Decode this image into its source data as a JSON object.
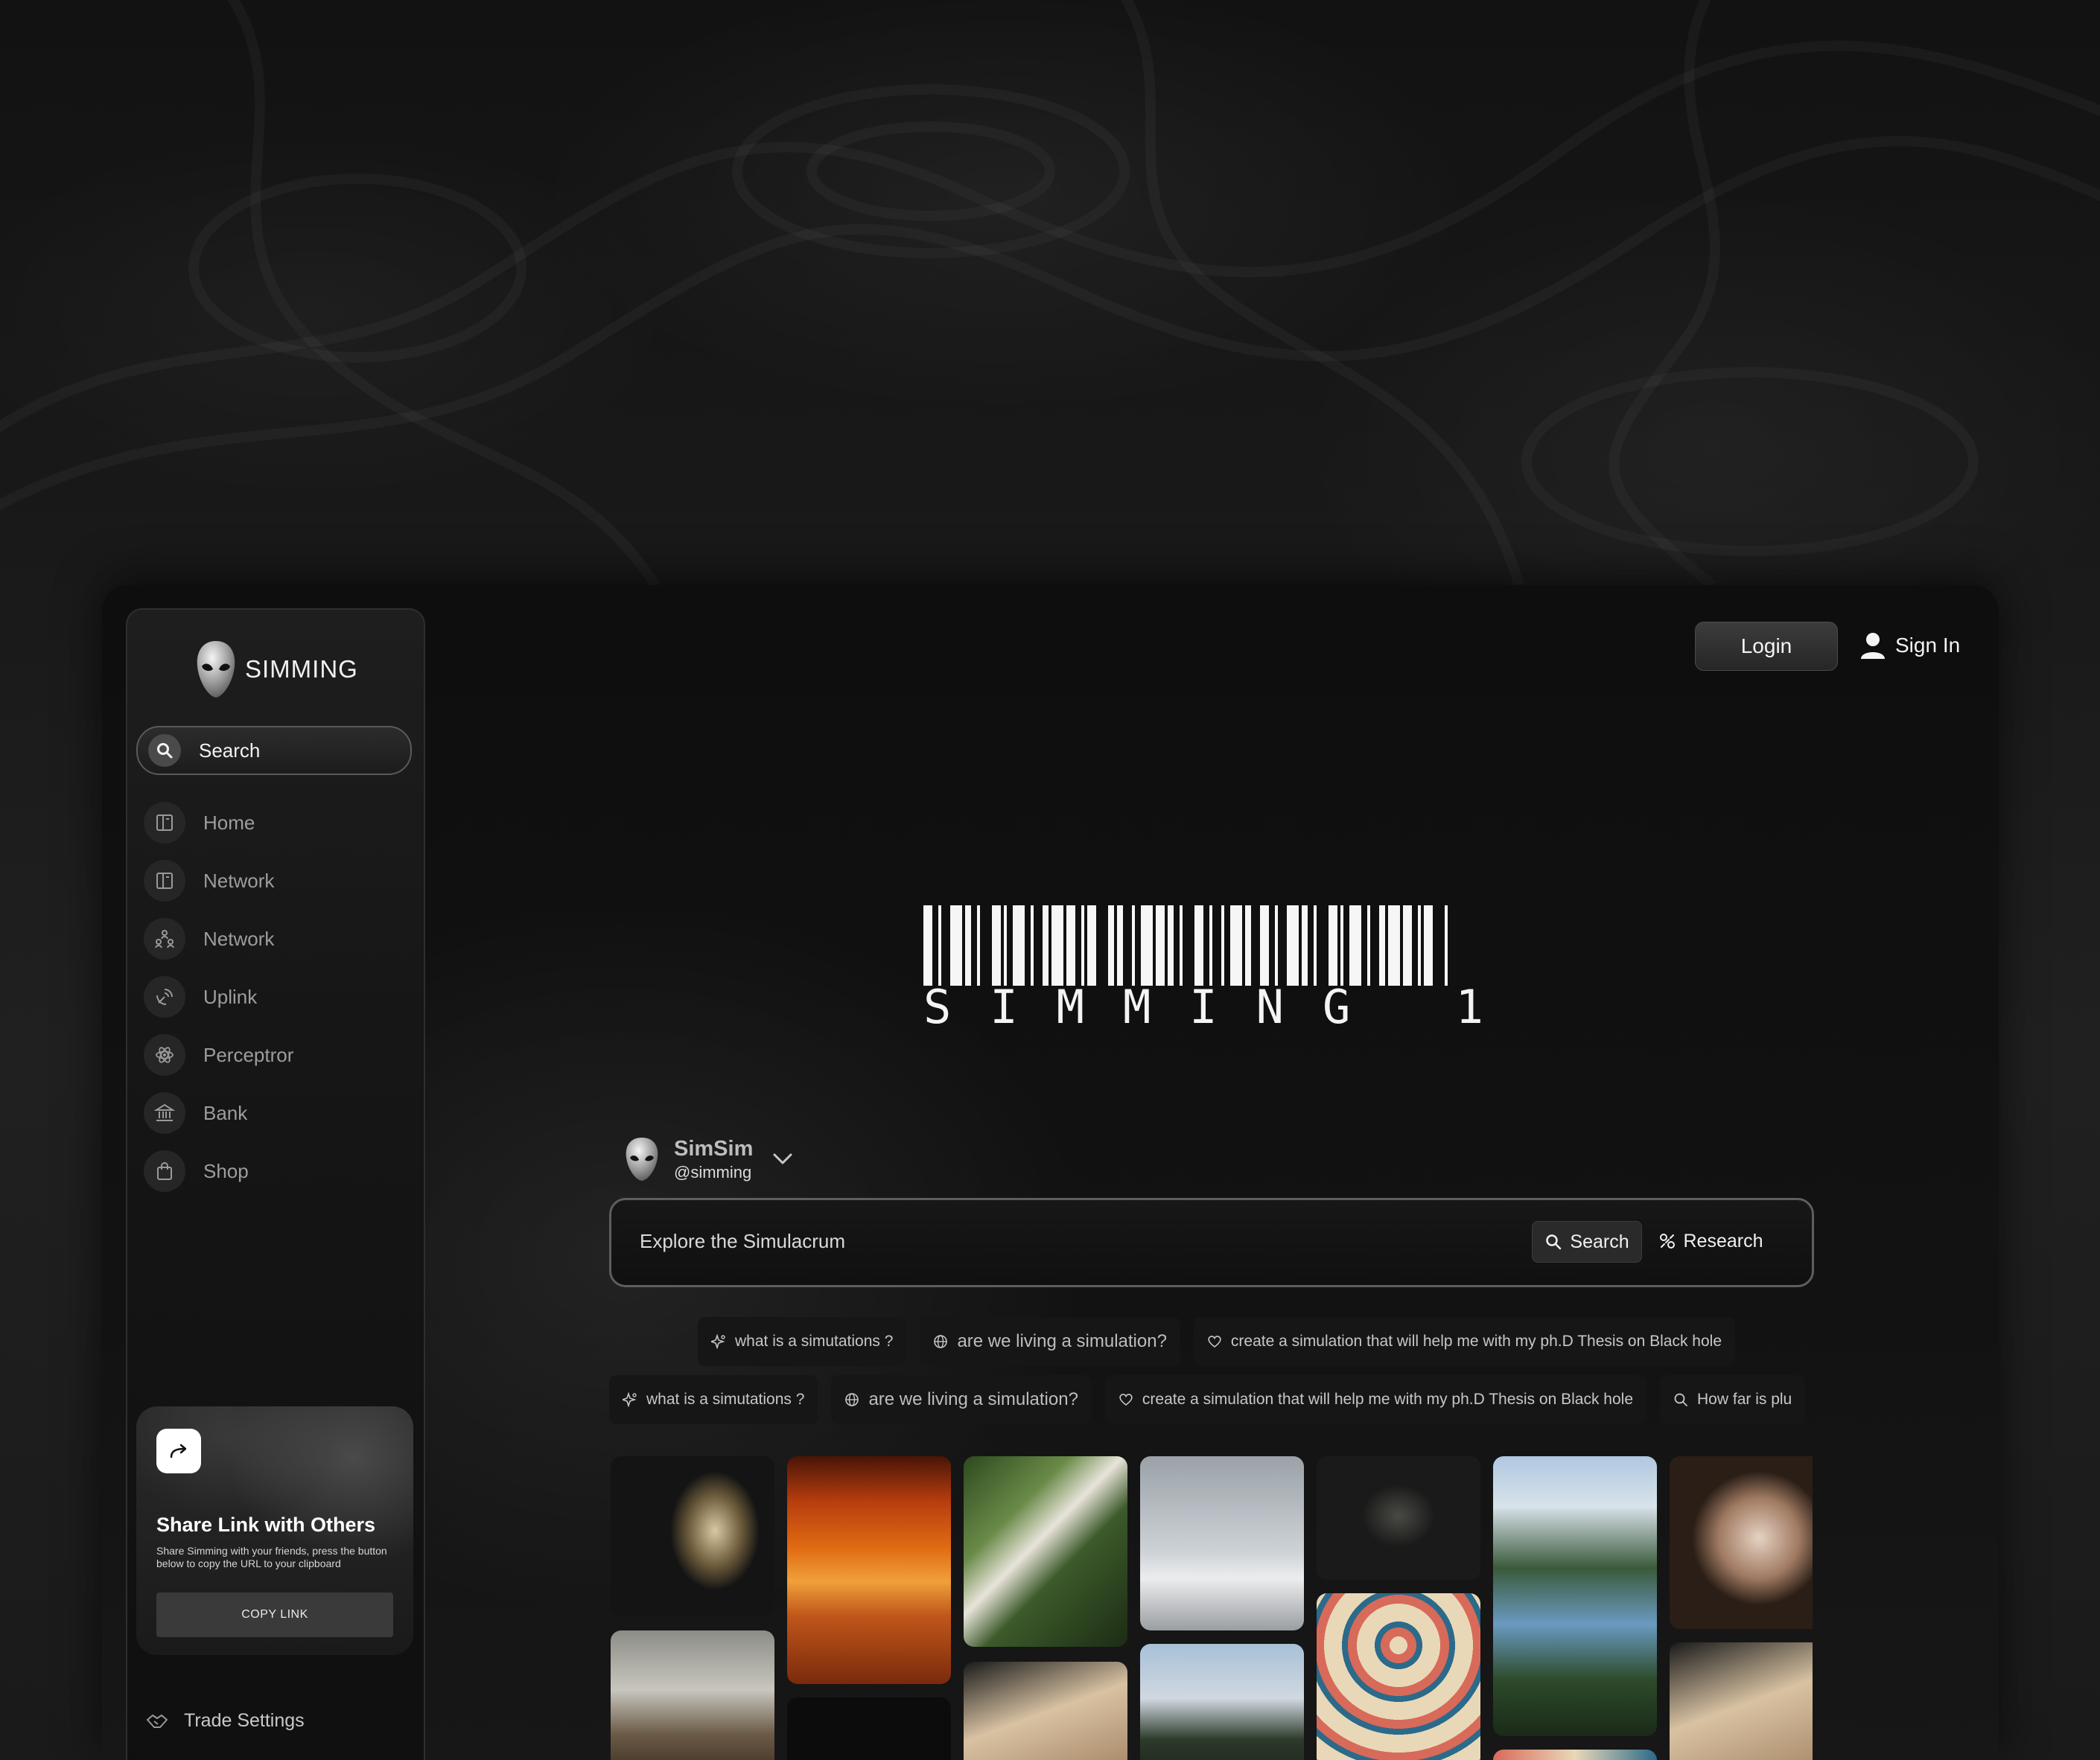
{
  "brand": {
    "name": "SIMMING"
  },
  "sidebar": {
    "search_label": "Search",
    "items": [
      {
        "label": "Home",
        "icon": "panel-icon"
      },
      {
        "label": "Network",
        "icon": "panel-icon"
      },
      {
        "label": "Network",
        "icon": "people-network-icon"
      },
      {
        "label": "Uplink",
        "icon": "satellite-icon"
      },
      {
        "label": "Perceptror",
        "icon": "atom-icon"
      },
      {
        "label": "Bank",
        "icon": "bank-icon"
      },
      {
        "label": "Shop",
        "icon": "shopping-bag-icon"
      }
    ],
    "share": {
      "title": "Share Link with Others",
      "text": "Share Simming with your friends, press the button below to copy the URL to your clipboard",
      "button": "COPY LINK"
    },
    "footer": {
      "trade_settings": "Trade Settings"
    }
  },
  "header": {
    "login": "Login",
    "sign_in": "Sign In"
  },
  "hero": {
    "barcode_text": "SIMMING 1"
  },
  "user": {
    "name": "SimSim",
    "handle": "@simming"
  },
  "main_search": {
    "placeholder": "Explore the Simulacrum",
    "search_button": "Search",
    "research_button": "Research"
  },
  "suggestions_row1": [
    {
      "label": "what is a simutations ?",
      "icon": "sparkle-icon"
    },
    {
      "label": "are we living a simulation?",
      "icon": "globe-icon"
    },
    {
      "label": "create a simulation that will help me with my ph.D Thesis on Black hole",
      "icon": "heart-icon"
    }
  ],
  "suggestions_row2": [
    {
      "label": "what is a simutations ?",
      "icon": "sparkle-icon"
    },
    {
      "label": "are we living a simulation?",
      "icon": "globe-icon"
    },
    {
      "label": "create a simulation that will help me with my ph.D Thesis on Black hole",
      "icon": "heart-icon"
    },
    {
      "label": "How far is plu",
      "icon": "search-icon"
    }
  ],
  "colors": {
    "accent": "#ffffff",
    "background": "#141414",
    "panel": "#1a1a1a"
  }
}
